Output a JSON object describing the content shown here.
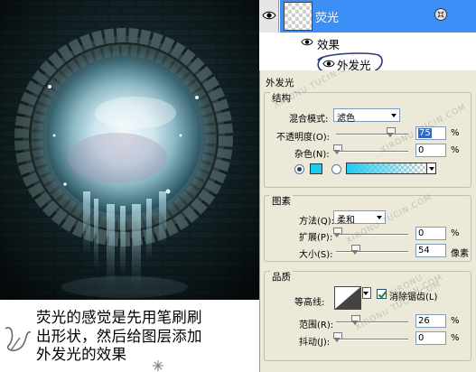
{
  "layers_panel": {
    "layer_name": "荧光",
    "effects_label": "效果",
    "outer_glow_label": "外发光"
  },
  "dialog": {
    "section_title": "外发光",
    "structure": {
      "title": "结构",
      "blend_mode_label": "混合模式:",
      "blend_mode_value": "滤色",
      "opacity_label": "不透明度",
      "opacity_key": "(O):",
      "opacity_value": "75",
      "noise_label": "杂色",
      "noise_key": "(N):",
      "noise_value": "0",
      "percent": "%",
      "glow_color": "#1ecbf0"
    },
    "elements": {
      "title": "图素",
      "method_label": "方法",
      "method_key": "(Q):",
      "method_value": "柔和",
      "spread_label": "扩展",
      "spread_key": "(P):",
      "spread_value": "0",
      "size_label": "大小",
      "size_key": "(S):",
      "size_value": "54",
      "size_unit": "像素",
      "percent": "%"
    },
    "quality": {
      "title": "品质",
      "contour_label": "等高线:",
      "anti_alias_label": "消除锯齿",
      "anti_alias_key": "(L)",
      "anti_alias_checked": true,
      "range_label": "范围",
      "range_key": "(R):",
      "range_value": "26",
      "jitter_label": "抖动",
      "jitter_key": "(J):",
      "jitter_value": "0",
      "percent": "%"
    }
  },
  "caption": {
    "line1": "荧光的感觉是先用笔刷刷",
    "line2": "出形状，然后给图层添加",
    "line3": "外发光的效果"
  },
  "watermarks": [
    "XIRONU TUCIN.COM",
    "XIRONU TUCIN.COM",
    "XIRONU TUCIN.COM",
    "XIRONU TUCIN.COM",
    "XIRONU TUCIN.COM"
  ]
}
